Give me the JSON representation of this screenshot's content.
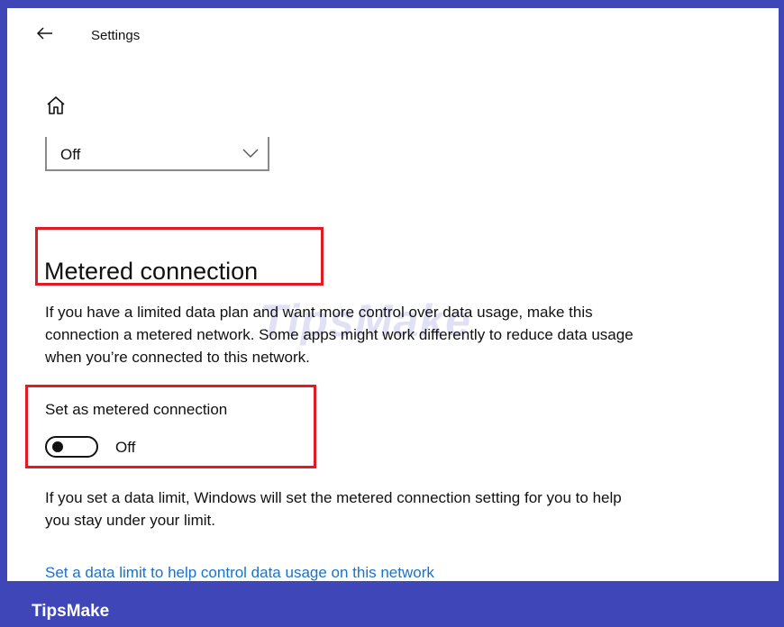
{
  "app": {
    "title": "Settings"
  },
  "dropdown": {
    "value": "Off"
  },
  "section": {
    "heading": "Metered connection",
    "description": "If you have a limited data plan and want more control over data usage, make this connection a metered network. Some apps might work differently to reduce data usage when you’re connected to this network."
  },
  "metered": {
    "label": "Set as metered connection",
    "state": "Off",
    "enabled": false
  },
  "data_limit": {
    "info": "If you set a data limit, Windows will set the metered connection setting for you to help you stay under your limit.",
    "link": "Set a data limit to help control data usage on this network"
  },
  "watermark": {
    "text": "TipsMake"
  },
  "footer": {
    "brand": "TipsMake"
  },
  "colors": {
    "frame": "#3f46b8",
    "highlight": "#e01b24",
    "link": "#1a73c9"
  },
  "icons": {
    "back": "arrow-left-icon",
    "home": "home-icon",
    "dropdown": "chevron-down-icon"
  }
}
